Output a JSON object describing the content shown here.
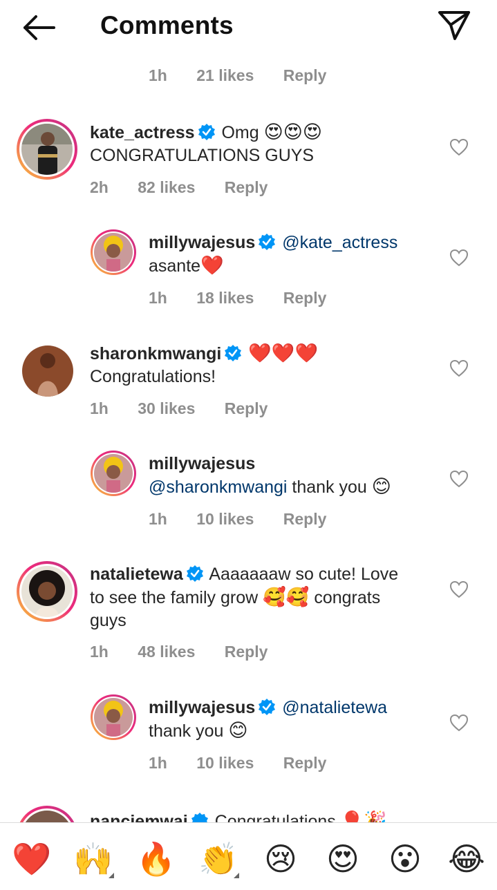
{
  "header": {
    "title": "Comments"
  },
  "top_reply_meta": {
    "time": "1h",
    "likes": "21 likes",
    "reply": "Reply"
  },
  "comments": [
    {
      "username": "kate_actress",
      "text": "Omg",
      "emoji": "😍😍😍",
      "text2": "CONGRATULATIONS GUYS",
      "time": "2h",
      "likes": "82 likes",
      "reply": "Reply"
    },
    {
      "username": "millywajesus",
      "mention": "@kate_actress",
      "text": "asante",
      "emoji": "❤️",
      "time": "1h",
      "likes": "18 likes",
      "reply": "Reply"
    },
    {
      "username": "sharonkmwangi",
      "emoji": "❤️❤️❤️",
      "text": "Congratulations!",
      "time": "1h",
      "likes": "30 likes",
      "reply": "Reply"
    },
    {
      "username": "millywajesus",
      "mention": "@sharonkmwangi",
      "text": "thank you",
      "emoji": "😊",
      "time": "1h",
      "likes": "10 likes",
      "reply": "Reply"
    },
    {
      "username": "natalietewa",
      "text": "Aaaaaaaw so cute! Love",
      "text2": "to see the family grow",
      "emoji": "🥰🥰",
      "text3": "congrats",
      "text4": "guys",
      "time": "1h",
      "likes": "48 likes",
      "reply": "Reply"
    },
    {
      "username": "millywajesus",
      "mention": "@natalietewa",
      "text": "thank you",
      "emoji": "😊",
      "time": "1h",
      "likes": "10 likes",
      "reply": "Reply"
    }
  ],
  "partial_comment": {
    "username": "nanciemwai",
    "text": "Congratulations",
    "emoji": "🎈🎉"
  },
  "emoji_bar": [
    "❤️",
    "🙌",
    "🔥",
    "👏",
    "😢",
    "😍",
    "😮",
    "😂"
  ],
  "colors": {
    "verified_blue": "#0095f6",
    "mention_blue": "#00376b",
    "meta_gray": "#8e8e8e",
    "heart_red": "#e0245e"
  }
}
